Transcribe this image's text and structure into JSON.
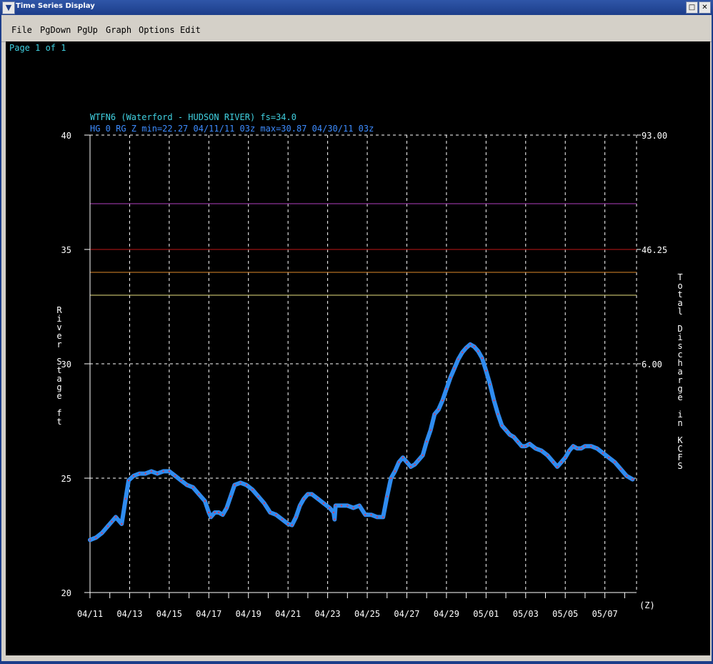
{
  "window": {
    "title": "Time Series Display",
    "menu": [
      "File",
      "PgDown",
      "PgUp",
      "Graph",
      "Options",
      "Edit"
    ]
  },
  "page_label": "Page 1 of 1",
  "chart_data": {
    "type": "line",
    "title": "WTFN6 (Waterford - HUDSON RIVER) fs=34.0",
    "subtitle": "HG 0 RG Z min=22.27 04/11/11 03z max=30.87 04/30/11 03z",
    "ylabel": "River Stage ft",
    "y2label": "Total Discharge in KCFS",
    "xunit_label": "(Z)",
    "ylim": [
      20,
      40
    ],
    "yticks": [
      20,
      25,
      30,
      35,
      40
    ],
    "y2ticks": [
      {
        "stage": 40,
        "label": "93.00"
      },
      {
        "stage": 35,
        "label": "46.25"
      },
      {
        "stage": 30,
        "label": "6.00"
      }
    ],
    "x_start": "04/11",
    "x_end_day": 27.6,
    "xticks": [
      {
        "day": 0,
        "label": "04/11"
      },
      {
        "day": 2,
        "label": "04/13"
      },
      {
        "day": 4,
        "label": "04/15"
      },
      {
        "day": 6,
        "label": "04/17"
      },
      {
        "day": 8,
        "label": "04/19"
      },
      {
        "day": 10,
        "label": "04/21"
      },
      {
        "day": 12,
        "label": "04/23"
      },
      {
        "day": 14,
        "label": "04/25"
      },
      {
        "day": 16,
        "label": "04/27"
      },
      {
        "day": 18,
        "label": "04/29"
      },
      {
        "day": 20,
        "label": "05/01"
      },
      {
        "day": 22,
        "label": "05/03"
      },
      {
        "day": 24,
        "label": "05/05"
      },
      {
        "day": 26,
        "label": "05/07"
      }
    ],
    "threshold_lines": [
      {
        "stage": 37,
        "color": "#b040c0"
      },
      {
        "stage": 35,
        "color": "#c01818"
      },
      {
        "stage": 34,
        "color": "#e08a2a"
      },
      {
        "stage": 33,
        "color": "#e8e080"
      }
    ],
    "series": [
      {
        "color": "#2f8cf0",
        "points": [
          [
            0,
            22.3
          ],
          [
            0.3,
            22.4
          ],
          [
            0.6,
            22.6
          ],
          [
            0.9,
            22.9
          ],
          [
            1.1,
            23.1
          ],
          [
            1.3,
            23.3
          ],
          [
            1.6,
            23.0
          ],
          [
            1.8,
            24.1
          ],
          [
            1.95,
            24.9
          ],
          [
            2.2,
            25.1
          ],
          [
            2.5,
            25.2
          ],
          [
            2.8,
            25.2
          ],
          [
            3.1,
            25.3
          ],
          [
            3.4,
            25.2
          ],
          [
            3.7,
            25.3
          ],
          [
            4.0,
            25.3
          ],
          [
            4.3,
            25.1
          ],
          [
            4.6,
            24.9
          ],
          [
            4.9,
            24.7
          ],
          [
            5.2,
            24.6
          ],
          [
            5.5,
            24.3
          ],
          [
            5.8,
            24.0
          ],
          [
            6.0,
            23.5
          ],
          [
            6.1,
            23.3
          ],
          [
            6.3,
            23.5
          ],
          [
            6.5,
            23.5
          ],
          [
            6.7,
            23.4
          ],
          [
            6.9,
            23.7
          ],
          [
            7.1,
            24.2
          ],
          [
            7.3,
            24.7
          ],
          [
            7.6,
            24.8
          ],
          [
            7.9,
            24.7
          ],
          [
            8.2,
            24.5
          ],
          [
            8.5,
            24.2
          ],
          [
            8.8,
            23.9
          ],
          [
            9.1,
            23.5
          ],
          [
            9.4,
            23.4
          ],
          [
            9.7,
            23.2
          ],
          [
            10.0,
            23.0
          ],
          [
            10.2,
            22.95
          ],
          [
            10.4,
            23.3
          ],
          [
            10.6,
            23.8
          ],
          [
            10.8,
            24.1
          ],
          [
            11.0,
            24.3
          ],
          [
            11.2,
            24.3
          ],
          [
            11.5,
            24.1
          ],
          [
            11.8,
            23.9
          ],
          [
            12.1,
            23.7
          ],
          [
            12.3,
            23.5
          ],
          [
            12.35,
            23.2
          ],
          [
            12.4,
            23.8
          ],
          [
            12.7,
            23.8
          ],
          [
            13.0,
            23.8
          ],
          [
            13.3,
            23.7
          ],
          [
            13.6,
            23.8
          ],
          [
            13.9,
            23.4
          ],
          [
            14.2,
            23.4
          ],
          [
            14.5,
            23.3
          ],
          [
            14.8,
            23.3
          ],
          [
            15.0,
            24.2
          ],
          [
            15.2,
            25.0
          ],
          [
            15.4,
            25.3
          ],
          [
            15.6,
            25.7
          ],
          [
            15.8,
            25.9
          ],
          [
            16.0,
            25.7
          ],
          [
            16.2,
            25.5
          ],
          [
            16.4,
            25.6
          ],
          [
            16.6,
            25.8
          ],
          [
            16.8,
            26.0
          ],
          [
            17.0,
            26.6
          ],
          [
            17.2,
            27.1
          ],
          [
            17.4,
            27.8
          ],
          [
            17.6,
            28.0
          ],
          [
            17.8,
            28.4
          ],
          [
            18.0,
            28.9
          ],
          [
            18.2,
            29.4
          ],
          [
            18.4,
            29.8
          ],
          [
            18.6,
            30.2
          ],
          [
            18.8,
            30.5
          ],
          [
            19.0,
            30.7
          ],
          [
            19.2,
            30.85
          ],
          [
            19.4,
            30.75
          ],
          [
            19.6,
            30.55
          ],
          [
            19.8,
            30.25
          ],
          [
            20.0,
            29.7
          ],
          [
            20.2,
            29.1
          ],
          [
            20.4,
            28.4
          ],
          [
            20.6,
            27.8
          ],
          [
            20.8,
            27.3
          ],
          [
            21.0,
            27.1
          ],
          [
            21.2,
            26.9
          ],
          [
            21.4,
            26.8
          ],
          [
            21.6,
            26.6
          ],
          [
            21.8,
            26.4
          ],
          [
            22.0,
            26.4
          ],
          [
            22.2,
            26.5
          ],
          [
            22.5,
            26.3
          ],
          [
            22.8,
            26.2
          ],
          [
            23.1,
            26.0
          ],
          [
            23.4,
            25.7
          ],
          [
            23.6,
            25.5
          ],
          [
            23.8,
            25.7
          ],
          [
            24.0,
            25.9
          ],
          [
            24.2,
            26.2
          ],
          [
            24.4,
            26.4
          ],
          [
            24.6,
            26.3
          ],
          [
            24.8,
            26.3
          ],
          [
            25.0,
            26.4
          ],
          [
            25.3,
            26.4
          ],
          [
            25.6,
            26.3
          ],
          [
            25.9,
            26.1
          ],
          [
            26.2,
            25.9
          ],
          [
            26.5,
            25.7
          ],
          [
            26.8,
            25.4
          ],
          [
            27.1,
            25.1
          ],
          [
            27.4,
            24.95
          ]
        ]
      }
    ]
  }
}
